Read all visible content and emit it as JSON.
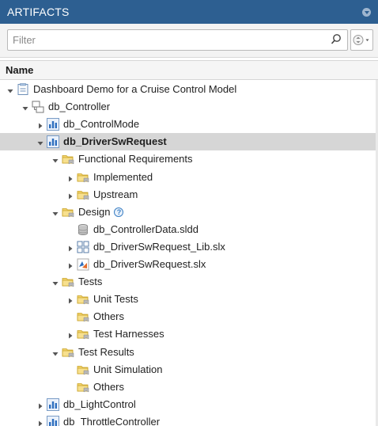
{
  "panel": {
    "title": "ARTIFACTS"
  },
  "filter": {
    "placeholder": "Filter"
  },
  "columns": {
    "name": "Name"
  },
  "colors": {
    "header_bg": "#2d5f91",
    "selected_bg": "#d6d6d6",
    "folder_yellow": "#f2c94c",
    "model_blue": "#2e6fbf"
  },
  "tree": [
    {
      "label": "Dashboard Demo for a Cruise Control Model",
      "depth": 0,
      "expander": "expanded",
      "icon": "project-icon"
    },
    {
      "label": "db_Controller",
      "depth": 1,
      "expander": "expanded",
      "icon": "hierarchy-icon"
    },
    {
      "label": "db_ControlMode",
      "depth": 2,
      "expander": "collapsed",
      "icon": "model-icon"
    },
    {
      "label": "db_DriverSwRequest",
      "depth": 2,
      "expander": "expanded",
      "icon": "model-icon",
      "selected": true
    },
    {
      "label": "Functional Requirements",
      "depth": 3,
      "expander": "expanded",
      "icon": "folder-icon"
    },
    {
      "label": "Implemented",
      "depth": 4,
      "expander": "collapsed",
      "icon": "folder-icon"
    },
    {
      "label": "Upstream",
      "depth": 4,
      "expander": "collapsed",
      "icon": "folder-icon"
    },
    {
      "label": "Design",
      "depth": 3,
      "expander": "expanded",
      "icon": "folder-icon",
      "help": true
    },
    {
      "label": "db_ControllerData.sldd",
      "depth": 4,
      "expander": "none",
      "icon": "data-dictionary-icon"
    },
    {
      "label": "db_DriverSwRequest_Lib.slx",
      "depth": 4,
      "expander": "collapsed",
      "icon": "library-icon"
    },
    {
      "label": "db_DriverSwRequest.slx",
      "depth": 4,
      "expander": "collapsed",
      "icon": "simulink-model-icon"
    },
    {
      "label": "Tests",
      "depth": 3,
      "expander": "expanded",
      "icon": "folder-icon"
    },
    {
      "label": "Unit Tests",
      "depth": 4,
      "expander": "collapsed",
      "icon": "folder-icon"
    },
    {
      "label": "Others",
      "depth": 4,
      "expander": "none",
      "icon": "folder-icon"
    },
    {
      "label": "Test Harnesses",
      "depth": 4,
      "expander": "collapsed",
      "icon": "folder-icon"
    },
    {
      "label": "Test Results",
      "depth": 3,
      "expander": "expanded",
      "icon": "folder-icon"
    },
    {
      "label": "Unit Simulation",
      "depth": 4,
      "expander": "none",
      "icon": "folder-icon"
    },
    {
      "label": "Others",
      "depth": 4,
      "expander": "none",
      "icon": "folder-icon"
    },
    {
      "label": "db_LightControl",
      "depth": 2,
      "expander": "collapsed",
      "icon": "model-icon"
    },
    {
      "label": "db_ThrottleController",
      "depth": 2,
      "expander": "collapsed",
      "icon": "model-icon"
    }
  ]
}
